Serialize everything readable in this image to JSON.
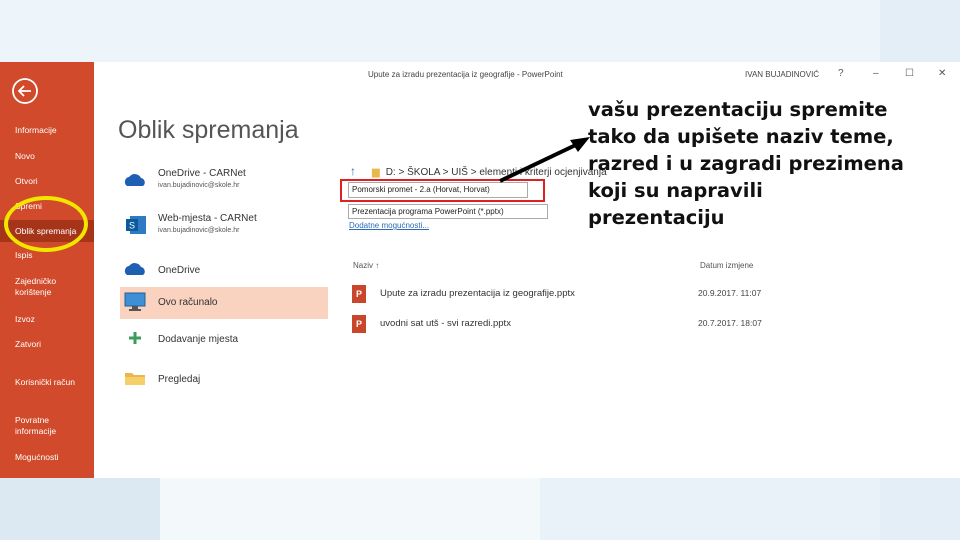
{
  "window": {
    "title": "Upute za izradu prezentacija iz geografije - PowerPoint",
    "user": "IVAN BUJADINOVIĆ",
    "help": "?",
    "minimize": "–",
    "maximize": "☐",
    "close": "✕"
  },
  "sidebar": {
    "items": [
      {
        "label": "Informacije"
      },
      {
        "label": "Novo"
      },
      {
        "label": "Otvori"
      },
      {
        "label": "Spremi"
      },
      {
        "label": "Oblik spremanja",
        "selected": true
      },
      {
        "label": "Ispis"
      },
      {
        "label": "Zajedničko korištenje"
      },
      {
        "label": "Izvoz"
      },
      {
        "label": "Zatvori"
      },
      {
        "label": "Korisnički račun"
      },
      {
        "label": "Povratne informacije"
      },
      {
        "label": "Mogućnosti"
      }
    ]
  },
  "page": {
    "title": "Oblik spremanja"
  },
  "locations": [
    {
      "name": "OneDrive - CARNet",
      "sub": "ivan.bujadinovic@skole.hr",
      "icon": "cloud-icon"
    },
    {
      "name": "Web-mjesta - CARNet",
      "sub": "ivan.bujadinovic@skole.hr",
      "icon": "sharepoint-icon"
    },
    {
      "name": "OneDrive",
      "sub": "",
      "icon": "cloud-icon"
    },
    {
      "name": "Ovo računalo",
      "sub": "",
      "icon": "computer-icon",
      "selected": true
    },
    {
      "name": "Dodavanje mjesta",
      "sub": "",
      "icon": "plus-icon"
    },
    {
      "name": "Pregledaj",
      "sub": "",
      "icon": "folder-icon"
    }
  ],
  "save": {
    "path": "D: > ŠKOLA > UIŠ > elementi i kriterji ocjenjivanja",
    "filename": "Pomorski promet - 2.a (Horvat, Horvat)",
    "filetype": "Prezentacija programa PowerPoint (*.pptx)",
    "more_options": "Dodatne mogućnosti..."
  },
  "columns": {
    "name": "Naziv ↑",
    "date": "Datum izmjene"
  },
  "files": [
    {
      "name": "Upute za izradu prezentacija iz geografije.pptx",
      "date": "20.9.2017. 11:07"
    },
    {
      "name": "uvodni sat utš - svi razredi.pptx",
      "date": "20.7.2017. 18:07"
    }
  ],
  "annotation": {
    "text": "vašu prezentaciju spremite\n tako da upišete naziv teme,\nrazred i u zagradi prezimena\nkoji su napravili\nprezentaciju"
  },
  "colors": {
    "accent": "#d04a2b",
    "highlight": "#f2e600",
    "marker": "#e02020"
  }
}
